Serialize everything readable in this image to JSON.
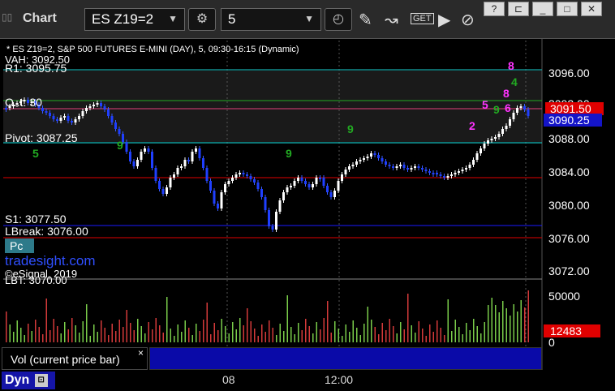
{
  "toolbar": {
    "title": "Chart",
    "symbol_value": "ES Z19=2",
    "interval_value": "5",
    "get_label": "GET"
  },
  "chart_header": "* ES Z19=2, S&P 500 FUTURES E-MINI (DAY), 5, 09:30-16:15 (Dynamic)",
  "levels": {
    "vah": "VAH: 3092.50",
    "r1": "R1: 3095.75",
    "pivot": "Pivot: 3087.25",
    "s1": "S1: 3077.50",
    "lbreak": "LBreak: 3076.00",
    "lbt": "LBT: 3070.00",
    "opt": "O..t: 30"
  },
  "price_axis": [
    "3096.00",
    "3092.00",
    "3088.00",
    "3084.00",
    "3080.00",
    "3076.00",
    "3072.00"
  ],
  "price_badges": {
    "red": "3091.50",
    "blue": "3090.25"
  },
  "volume": {
    "axis_top": "50000",
    "axis_zero": "0",
    "current": "12483",
    "legend": "Vol (current price bar)",
    "close": "×"
  },
  "time_axis": [
    "08",
    "12:00"
  ],
  "watermark": {
    "brand": "tradesight.com",
    "copyright": "©eSignal, 2019",
    "pc": "Pc"
  },
  "bottom": {
    "dyn": "Dyn"
  },
  "signals": [
    "8",
    "4",
    "5",
    "2",
    "9",
    "9",
    "9",
    "9",
    "5",
    "8",
    "6"
  ],
  "colors": {
    "up": "#ffffff",
    "down": "#1f3fff",
    "r1": "#00b7b7",
    "pivot": "#00d0d0",
    "support": "#e00000",
    "green": "#22aa22",
    "magenta": "#ff33ff"
  }
}
